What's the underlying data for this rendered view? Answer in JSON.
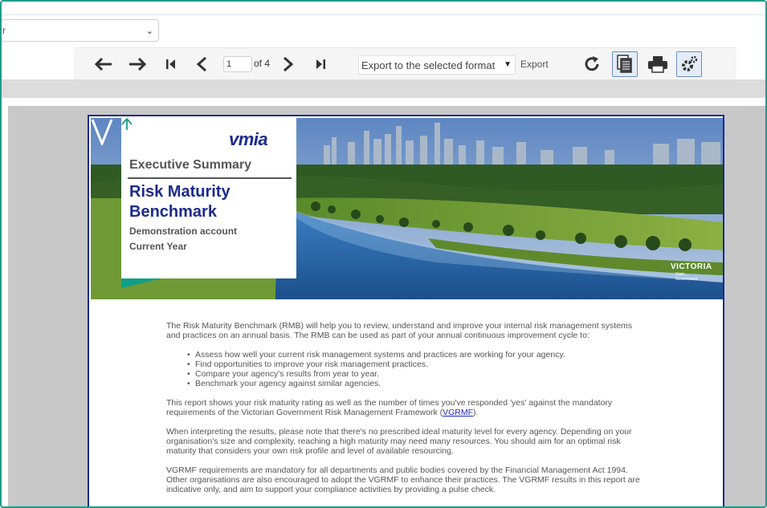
{
  "selector": {
    "value": "r"
  },
  "toolbar": {
    "page_value": "1",
    "page_of": "of 4",
    "format_placeholder": "Export to the selected format",
    "export_label": "Export"
  },
  "report": {
    "logo_text": "vmia",
    "heading": "Executive Summary",
    "title_line1": "Risk Maturity",
    "title_line2": "Benchmark",
    "account": "Demonstration account",
    "period": "Current Year",
    "vic_word": "VICTORIA",
    "vic_sub": "State Government",
    "intro": "The Risk Maturity Benchmark (RMB) will help you to review, understand and improve your internal risk management systems and practices on an annual basis. The RMB can be used as part of your annual continuous improvement cycle to:",
    "bullets": [
      "Assess how well your current risk management systems and practices are working for your agency.",
      "Find opportunities to improve your risk management practices.",
      "Compare your agency's results from year to year.",
      "Benchmark your agency against similar agencies."
    ],
    "para2_prefix": "This report shows your risk maturity rating as well as the number of times you've responded 'yes' against the mandatory requirements of the Victorian Government Risk Management Framework (",
    "para2_link": "VGRMF",
    "para2_suffix": ").",
    "para3": "When interpreting the results, please note that there's no prescribed ideal maturity level for every agency. Depending on your organisation's size and complexity, reaching a high maturity may need many resources. You should aim for an optimal risk maturity that considers your own risk profile and level of available resourcing.",
    "para4": "VGRMF requirements are mandatory for all departments and public bodies covered by the Financial Management Act 1994. Other organisations are also encouraged to adopt the VGRMF to enhance their practices. The VGRMF results in this report are indicative only, and aim to support your compliance activities by providing a pulse check."
  },
  "colors": {
    "frame": "#1a9c8a",
    "brand_navy": "#1b2b8c",
    "toolbar_bg": "#f5f5f5"
  },
  "icons": [
    "arrow-left-icon",
    "arrow-right-icon",
    "first-page-icon",
    "prev-page-icon",
    "next-page-icon",
    "last-page-icon",
    "refresh-icon",
    "document-map-icon",
    "print-icon",
    "settings-icon"
  ]
}
